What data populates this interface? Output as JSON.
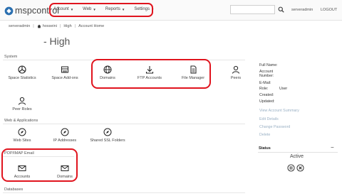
{
  "app": {
    "logo": "mspcontrol"
  },
  "nav": {
    "menu": [
      "Account",
      "Web",
      "Reports",
      "Settings"
    ],
    "search_placeholder": "",
    "user": "serveradmin",
    "logout": "LOGOUT"
  },
  "breadcrumb": [
    "serveradmin",
    "hosseini",
    "High",
    "Account Home"
  ],
  "page": {
    "title": "- High"
  },
  "sections": {
    "system": {
      "label": "System",
      "tiles": [
        "Space Statistics",
        "Space Add-ons",
        "Domains",
        "FTP Accounts",
        "File Manager",
        "Peers",
        "Peer Roles"
      ]
    },
    "web": {
      "label": "Web & Applications",
      "tiles": [
        "Web Sites",
        "IP Addresses",
        "Shared SSL Folders"
      ]
    },
    "email": {
      "label": "POP/IMAP Email",
      "tiles": [
        "Accounts",
        "Domains"
      ]
    },
    "databases": {
      "label": "Databases"
    }
  },
  "info": {
    "full_name": "Full Name:",
    "account_number": "Account Number:",
    "email": "E-Mail:",
    "role_label": "Role:",
    "role_value": "User",
    "created": "Created:",
    "updated": "Updated:",
    "links": [
      "View Account Summary",
      "Edit Details",
      "Change Password",
      "Delete"
    ]
  },
  "status": {
    "title": "Status",
    "toggle": "−",
    "state": "Active"
  },
  "colors": {
    "highlight": "#e0141e",
    "link": "#9ab0c4",
    "accent": "#1f6fb2"
  }
}
